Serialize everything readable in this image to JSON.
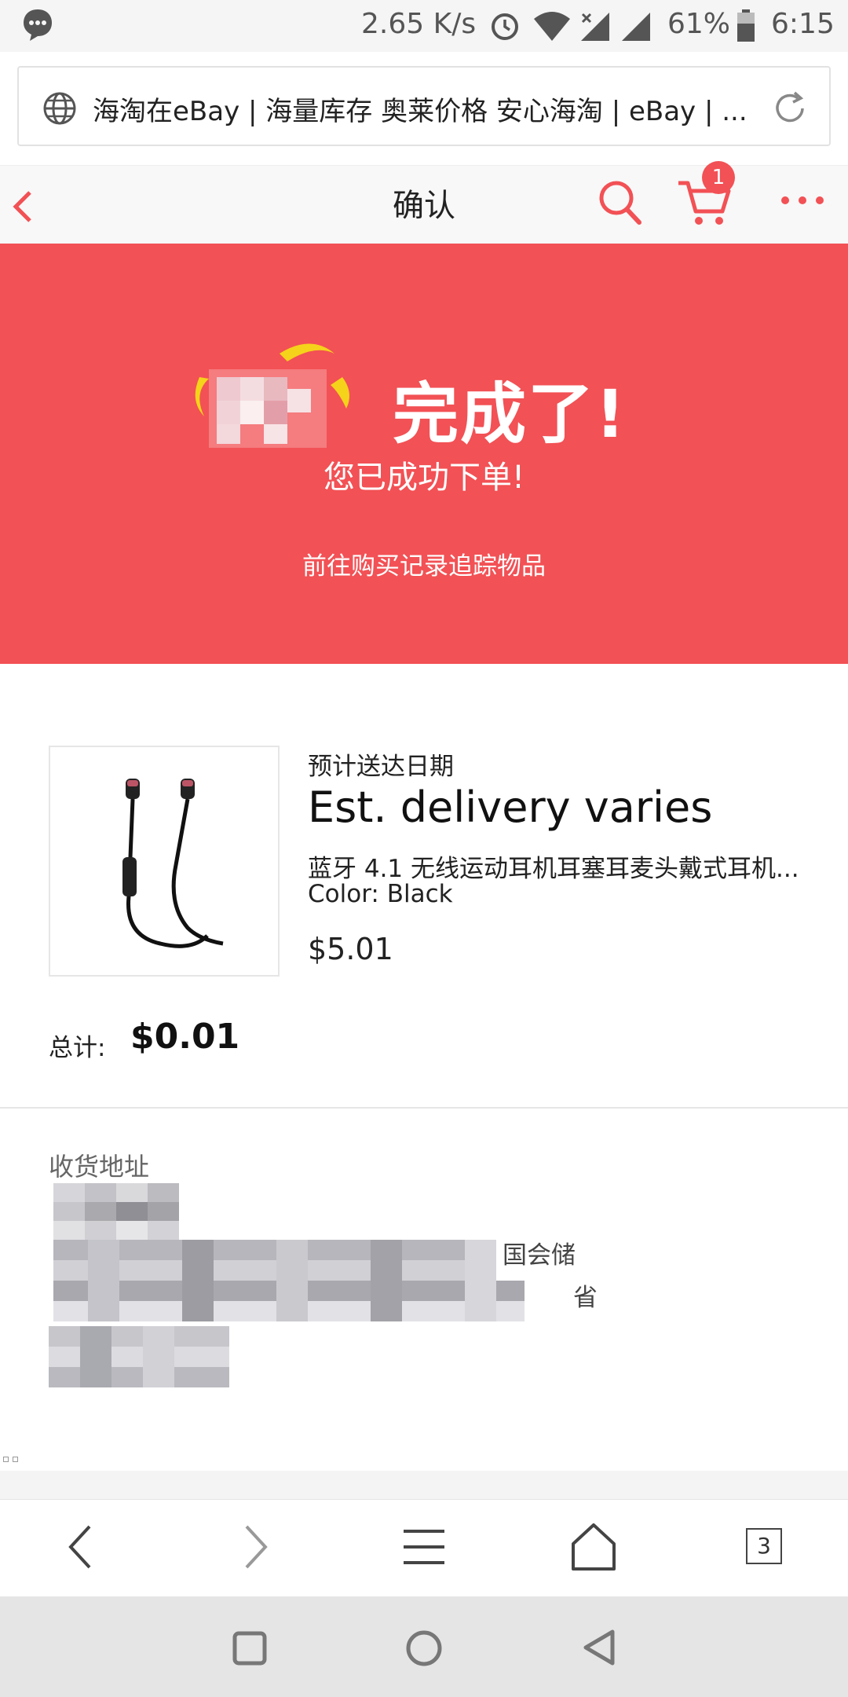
{
  "status_bar": {
    "speed": "2.65 K/s",
    "battery": "61%",
    "time": "6:15"
  },
  "url_bar": {
    "text": "海淘在eBay | 海量库存 奥莱价格 安心海淘 | eBay | ..."
  },
  "header": {
    "title": "确认",
    "cart_count": "1"
  },
  "hero": {
    "title": "完成了!",
    "subtitle": "您已成功下单!",
    "link": "前往购买记录追踪物品"
  },
  "item": {
    "delivery_label": "预计送达日期",
    "delivery_value": "Est. delivery varies",
    "description": "蓝牙 4.1 无线运动耳机耳塞耳麦头戴式耳机...",
    "color": "Color: Black",
    "price": "$5.01"
  },
  "total": {
    "label": "总计:",
    "value": "$0.01"
  },
  "address": {
    "label": "收货地址",
    "fragment1": "国会储",
    "fragment2": "省"
  },
  "browser_nav": {
    "tabs": "3"
  },
  "icons": {
    "back": "chevron-left-icon",
    "search": "search-icon",
    "cart": "cart-icon",
    "more": "more-icon"
  },
  "colors": {
    "accent": "#f25155",
    "hero_bg": "#f25155",
    "text": "#222222"
  }
}
